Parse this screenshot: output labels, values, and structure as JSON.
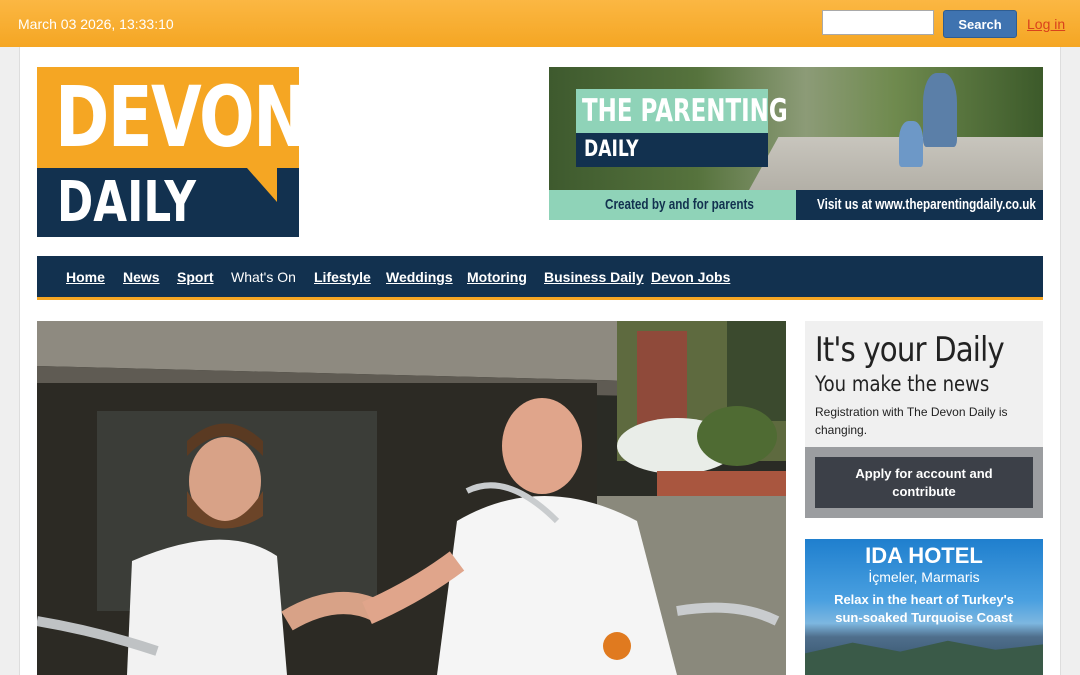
{
  "topbar": {
    "datetime": "March 03 2026, 13:33:10",
    "search_placeholder": "",
    "search_button": "Search",
    "login": "Log in"
  },
  "logo": {
    "line1": "DEVON",
    "line2": "DAILY"
  },
  "ad_banner": {
    "title_line1": "THE PARENTING",
    "title_line2": "DAILY",
    "tagline": "Created by and for parents",
    "url": "Visit us at www.theparentingdaily.co.uk"
  },
  "nav": {
    "items": [
      {
        "label": "Home",
        "active": true
      },
      {
        "label": "News",
        "active": true
      },
      {
        "label": "Sport",
        "active": true
      },
      {
        "label": "What's On",
        "active": false
      },
      {
        "label": "Lifestyle",
        "active": true
      },
      {
        "label": "Weddings",
        "active": true
      },
      {
        "label": "Motoring",
        "active": true
      },
      {
        "label": "Business Daily",
        "active": true
      },
      {
        "label": "Devon Jobs",
        "active": true
      }
    ]
  },
  "promo": {
    "heading": "It's your Daily",
    "subheading": "You make the news",
    "body": "Registration with The Devon Daily is changing.",
    "cta": "Apply for account and contribute"
  },
  "hotel_ad": {
    "name": "IDA HOTEL",
    "location": "İçmeler, Marmaris",
    "line1": "Relax in the heart of Turkey's",
    "line2": "sun-soaked Turquoise Coast"
  },
  "colors": {
    "brand_orange": "#f5a623",
    "brand_navy": "#12314f",
    "search_button": "#3f73b0",
    "login_link": "#d9421c",
    "cta_dark": "#3c4048"
  }
}
